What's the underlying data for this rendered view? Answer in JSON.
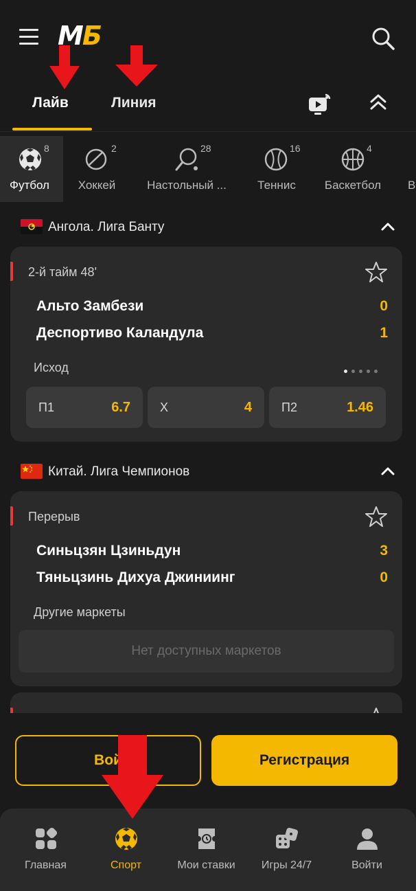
{
  "header": {
    "logo": "МБ"
  },
  "tabs": [
    {
      "label": "Лайв",
      "active": true
    },
    {
      "label": "Линия",
      "active": false
    }
  ],
  "sports": [
    {
      "label": "Футбол",
      "count": "8",
      "icon": "soccer-ball-icon",
      "active": true
    },
    {
      "label": "Хоккей",
      "count": "2",
      "icon": "hockey-puck-icon",
      "active": false
    },
    {
      "label": "Настольный ...",
      "count": "28",
      "icon": "ping-pong-icon",
      "active": false
    },
    {
      "label": "Теннис",
      "count": "16",
      "icon": "tennis-ball-icon",
      "active": false
    },
    {
      "label": "Баскетбол",
      "count": "4",
      "icon": "basketball-icon",
      "active": false
    },
    {
      "label": "В",
      "count": "",
      "icon": "",
      "active": false
    }
  ],
  "leagues": [
    {
      "name": "Ангола. Лига Банту",
      "flag": "angola-flag-icon",
      "match": {
        "status": "2-й тайм 48'",
        "team1": "Альто Замбези",
        "score1": "0",
        "team2": "Деспортиво Каландула",
        "score2": "1",
        "market_label": "Исход",
        "odds": [
          {
            "label": "П1",
            "value": "6.7"
          },
          {
            "label": "Х",
            "value": "4"
          },
          {
            "label": "П2",
            "value": "1.46"
          }
        ]
      }
    },
    {
      "name": "Китай. Лига Чемпионов",
      "flag": "china-flag-icon",
      "match": {
        "status": "Перерыв",
        "team1": "Синьцзян Цзиньдун",
        "score1": "3",
        "team2": "Тяньцзинь Дихуа Джиниинг",
        "score2": "0",
        "market_label": "Другие маркеты",
        "no_markets": "Нет доступных маркетов"
      }
    }
  ],
  "auth": {
    "login": "Войти",
    "login_visible": "Вой",
    "register": "Регистрация"
  },
  "bottom_nav": [
    {
      "label": "Главная",
      "icon": "grid-icon",
      "active": false
    },
    {
      "label": "Спорт",
      "icon": "soccer-ball-icon",
      "active": true
    },
    {
      "label": "Мои ставки",
      "icon": "ticket-icon",
      "active": false
    },
    {
      "label": "Игры 24/7",
      "icon": "dice-icon",
      "active": false
    },
    {
      "label": "Войти",
      "icon": "user-icon",
      "active": false
    }
  ],
  "colors": {
    "accent": "#f5b800",
    "background": "#1a1a1a",
    "card": "#2a2a2a",
    "live": "#e23b3b",
    "annotation_arrow": "#e8151b"
  }
}
